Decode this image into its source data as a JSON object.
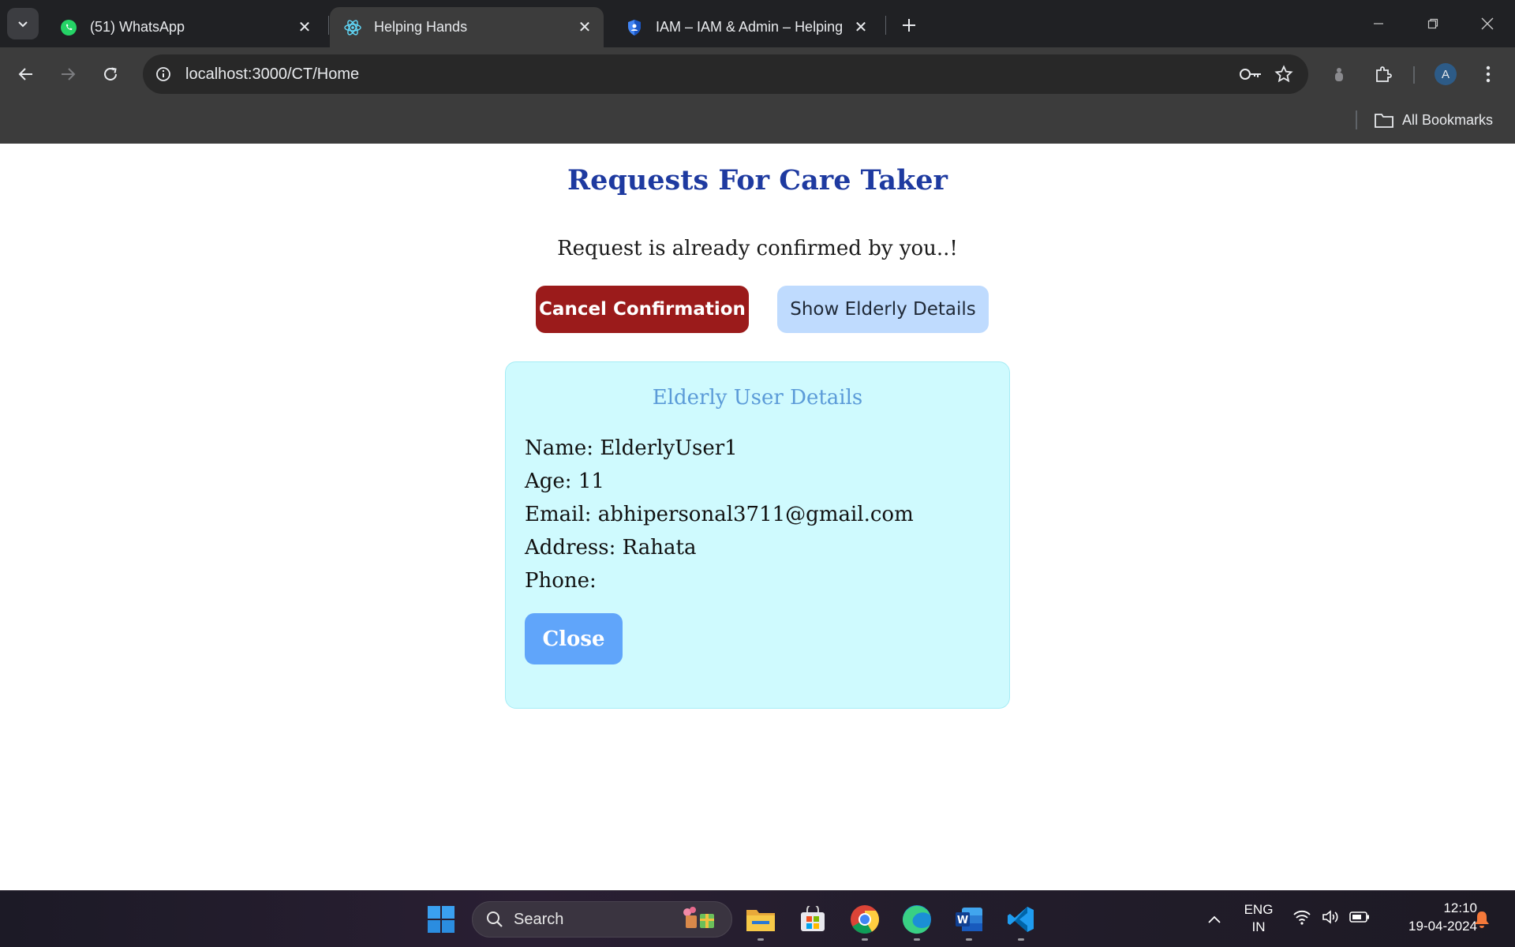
{
  "browser": {
    "tabs": [
      {
        "title": "(51) WhatsApp",
        "icon": "whatsapp-icon",
        "active": false
      },
      {
        "title": "Helping Hands",
        "icon": "react-icon",
        "active": true
      },
      {
        "title": "IAM – IAM & Admin – Helping",
        "icon": "cloud-shield-icon",
        "active": false
      }
    ],
    "url": "localhost:3000/CT/Home",
    "profile_initial": "A",
    "bookmarks_label": "All Bookmarks"
  },
  "page": {
    "title": "Requests For Care Taker",
    "status_message": "Request is already confirmed by you..!",
    "cancel_button": "Cancel Confirmation",
    "show_details_button": "Show Elderly Details",
    "details": {
      "title": "Elderly User Details",
      "name": "Name: ElderlyUser1",
      "age": "Age: 11",
      "email": "Email: abhipersonal3711@gmail.com",
      "address": "Address: Rahata",
      "phone": "Phone:",
      "close_button": "Close"
    }
  },
  "colors": {
    "title": "#1e3aa0",
    "cancel_button": "#9b1b1b",
    "show_button": "#bfdbfe",
    "card_bg": "#cffafe",
    "close_button": "#60a5fa"
  },
  "taskbar": {
    "search_placeholder": "Search",
    "language_line1": "ENG",
    "language_line2": "IN",
    "time": "12:10",
    "date": "19-04-2024",
    "apps": [
      "start-icon",
      "file-explorer-icon",
      "microsoft-store-icon",
      "chrome-icon",
      "edge-icon",
      "word-icon",
      "vscode-icon"
    ]
  }
}
